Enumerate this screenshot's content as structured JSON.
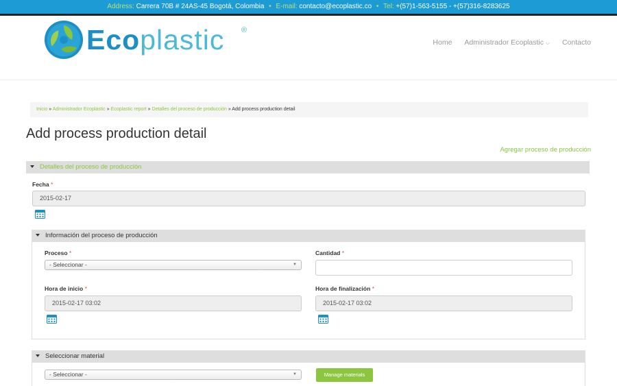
{
  "topbar": {
    "address_label": "Address:",
    "address_value": "Carrera 70B # 24AS-45 Bogotá, Colombia",
    "sep1": "•",
    "email_label": "E-mail:",
    "email_value": "contacto@ecoplastic.co",
    "sep2": "•",
    "tel_label": "Tel:",
    "tel_value": "+(57)1-563-5155 - +(57)316-8283625"
  },
  "logo": {
    "eco": "Eco",
    "plastic": "plastic",
    "reg": "®"
  },
  "nav": {
    "items": [
      "Home",
      "Administrador Ecoplastic",
      "Contacto"
    ],
    "dropdown_glyph": "⌵"
  },
  "breadcrumb": {
    "links": [
      "Inicio",
      "Administrador Ecoplastic",
      "Ecoplastic report",
      "Detalles del proceso de producción"
    ],
    "separator": " » ",
    "current": "Add process production detail"
  },
  "page": {
    "title": "Add process production detail",
    "add_link": "Agregar proceso de producción"
  },
  "section_detalles": {
    "header": "Detalles del proceso de producción",
    "fecha_label": "Fecha",
    "required_mark": "*",
    "fecha_value": "2015-02-17"
  },
  "section_informacion": {
    "header": "Información del proceso de producción",
    "proceso_label": "Proceso",
    "proceso_value": "- Seleccionar -",
    "cantidad_label": "Cantidad",
    "cantidad_value": "",
    "hora_inicio_label": "Hora de inicio",
    "hora_inicio_value": "2015-02-17 03:02",
    "hora_fin_label": "Hora de finalización",
    "hora_fin_value": "2015-02-17 03:02"
  },
  "section_material": {
    "header": "Seleccionar material",
    "material_value": "- Seleccionar -",
    "manage_button": "Manage materials"
  },
  "colors": {
    "topbar_bg": "#1d9bd5",
    "accent_green": "#8cc63f",
    "logo_blue": "#1e8fc6",
    "logo_light_blue": "#4cb9d8",
    "required_red": "#e74c3c",
    "calendar_blue": "#1e8fc6"
  },
  "icons": {
    "calendar": "calendar-icon",
    "caret": "caret-down-icon",
    "select_arrow": "select-arrow-icon",
    "logo": "ecoplastic-logo-icon"
  }
}
